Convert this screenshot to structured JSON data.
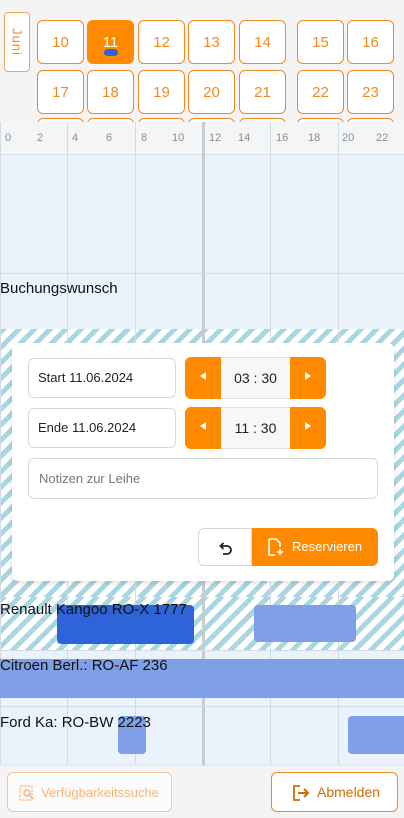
{
  "calendar": {
    "month": "Juni",
    "days": [
      "10",
      "11",
      "12",
      "13",
      "14",
      "15",
      "16",
      "17",
      "18",
      "19",
      "20",
      "21",
      "22",
      "23"
    ],
    "selected_day": "11"
  },
  "timeline": {
    "hours": [
      "0",
      "2",
      "4",
      "6",
      "8",
      "10",
      "12",
      "14",
      "16",
      "18",
      "20",
      "22"
    ],
    "booking_request_label": "Buchungswunsch",
    "vehicles": [
      {
        "label": "Renault Kangoo RO-X 1777"
      },
      {
        "label": "Citroen Berl.: RO-AF 236"
      },
      {
        "label": "Ford Ka: RO-BW 2223"
      }
    ]
  },
  "dialog": {
    "start_label": "Start 11.06.2024",
    "start_time": "03 : 30",
    "end_label": "Ende 11.06.2024",
    "end_time": "11 : 30",
    "notes_placeholder": "Notizen zur Leihe",
    "reserve_label": "Reservieren"
  },
  "footer": {
    "availability_label": "Verfügbarkeitssuche",
    "logout_label": "Abmelden"
  },
  "colors": {
    "accent": "#ff8a00",
    "booking_blue": "#2f64d8",
    "booking_light_blue": "#7f9fe6",
    "timeline_bg": "#eaf2fc"
  }
}
